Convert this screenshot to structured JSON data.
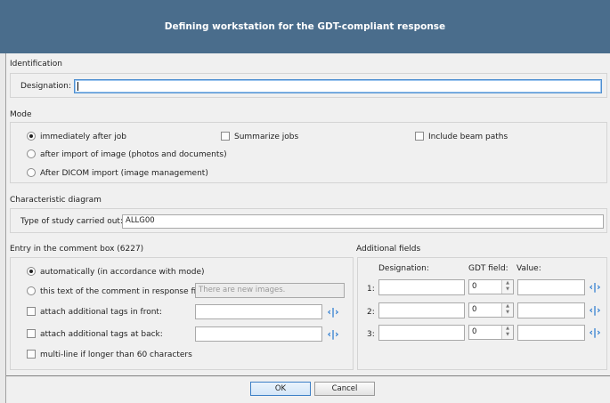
{
  "window": {
    "title": "Defining workstation for the GDT-compliant response"
  },
  "identification": {
    "header": "Identification",
    "designation_label": "Designation:",
    "designation_value": ""
  },
  "mode": {
    "header": "Mode",
    "options": [
      "immediately after job",
      "after import of image (photos and documents)",
      "After DICOM import (image management)"
    ],
    "selected": "immediately after job",
    "summarize_jobs": "Summarize jobs",
    "include_beam_paths": "Include beam paths"
  },
  "characteristic": {
    "header": "Characteristic diagram",
    "study_label": "Type of study carried out:",
    "study_value": "ALLG00"
  },
  "comment": {
    "header": "Entry in the comment box (6227)",
    "auto_label": "automatically (in accordance with mode)",
    "text_label": "this text of the comment in response file:",
    "text_placeholder": "There are new images.",
    "front_label": "attach additional tags in front:",
    "back_label": "attach additional tags at back:",
    "multiline_label": "multi-line if longer than 60 characters"
  },
  "additional": {
    "header": "Additional fields",
    "col_designation": "Designation:",
    "col_gdt": "GDT field:",
    "col_value": "Value:",
    "rows": [
      {
        "num": "1:",
        "gdt": "0"
      },
      {
        "num": "2:",
        "gdt": "0"
      },
      {
        "num": "3:",
        "gdt": "0"
      }
    ]
  },
  "buttons": {
    "ok": "OK",
    "cancel": "Cancel"
  },
  "icons": {
    "tag_picker": "angle-brackets-icon",
    "accent": "#2b7bd0",
    "titlebar": "#4a6d8c"
  }
}
